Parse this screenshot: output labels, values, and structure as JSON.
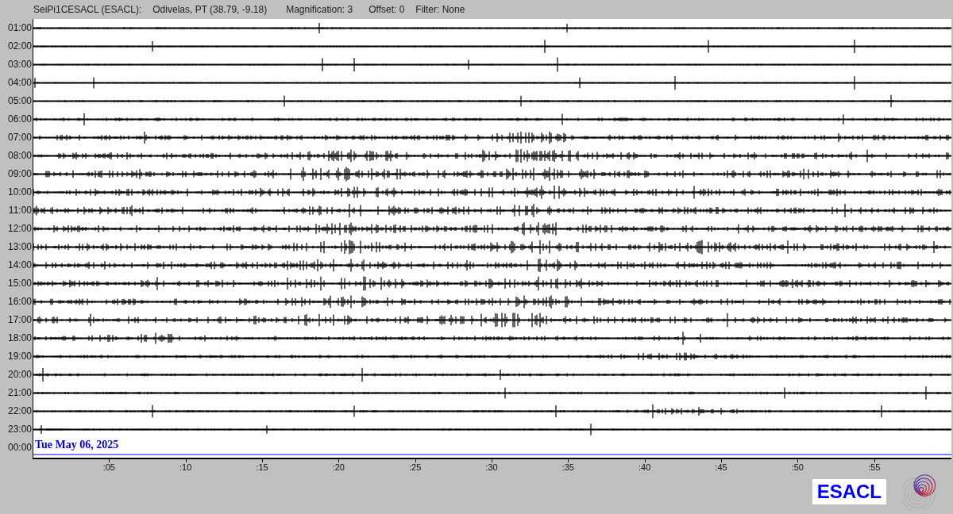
{
  "header": {
    "station": "SeiPi1CESACL (ESACL):",
    "location": "Odivelas, PT (38.79, -9.18)",
    "magnification": "Magnification: 3",
    "offset": "Offset: 0",
    "filter": "Filter: None"
  },
  "rows": [
    {
      "label": "01:00",
      "kind": "trace"
    },
    {
      "label": "02:00",
      "kind": "trace"
    },
    {
      "label": "03:00",
      "kind": "trace"
    },
    {
      "label": "04:00",
      "kind": "trace"
    },
    {
      "label": "05:00",
      "kind": "trace"
    },
    {
      "label": "06:00",
      "kind": "trace"
    },
    {
      "label": "07:00",
      "kind": "trace"
    },
    {
      "label": "08:00",
      "kind": "trace"
    },
    {
      "label": "09:00",
      "kind": "trace"
    },
    {
      "label": "10:00",
      "kind": "trace"
    },
    {
      "label": "11:00",
      "kind": "trace"
    },
    {
      "label": "12:00",
      "kind": "trace"
    },
    {
      "label": "13:00",
      "kind": "trace"
    },
    {
      "label": "14:00",
      "kind": "trace"
    },
    {
      "label": "15:00",
      "kind": "trace"
    },
    {
      "label": "16:00",
      "kind": "trace"
    },
    {
      "label": "17:00",
      "kind": "trace"
    },
    {
      "label": "18:00",
      "kind": "trace"
    },
    {
      "label": "19:00",
      "kind": "trace"
    },
    {
      "label": "20:00",
      "kind": "trace"
    },
    {
      "label": "21:00",
      "kind": "trace"
    },
    {
      "label": "22:00",
      "kind": "trace"
    },
    {
      "label": "23:00",
      "kind": "trace"
    },
    {
      "label": "00:00",
      "kind": "cursor"
    }
  ],
  "date_label": "Tue May 06, 2025",
  "minute_ticks": [
    ":05",
    ":10",
    ":15",
    ":20",
    ":25",
    ":30",
    ":35",
    ":40",
    ":45",
    ":50",
    ":55"
  ],
  "logo_text": "ESACL"
}
